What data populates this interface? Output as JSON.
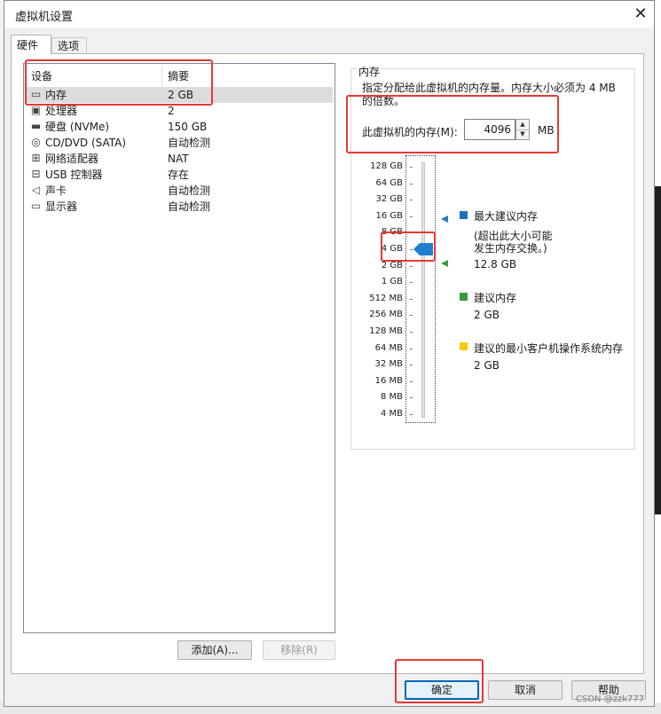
{
  "window": {
    "title": "虚拟机设置",
    "close": "✕"
  },
  "tabs": [
    {
      "label": "硬件"
    },
    {
      "label": "选项"
    }
  ],
  "device_table": {
    "headers": [
      "设备",
      "摘要"
    ],
    "rows": [
      {
        "name": "内存",
        "value": "2 GB",
        "icon": "memory-icon",
        "glyph": "▭"
      },
      {
        "name": "处理器",
        "value": "2",
        "icon": "cpu-icon",
        "glyph": "▣"
      },
      {
        "name": "硬盘 (NVMe)",
        "value": "150 GB",
        "icon": "harddisk-icon",
        "glyph": "▬"
      },
      {
        "name": "CD/DVD (SATA)",
        "value": "自动检测",
        "icon": "cd-icon",
        "glyph": "◎"
      },
      {
        "name": "网络适配器",
        "value": "NAT",
        "icon": "network-icon",
        "glyph": "⊞"
      },
      {
        "name": "USB 控制器",
        "value": "存在",
        "icon": "usb-icon",
        "glyph": "⊟"
      },
      {
        "name": "声卡",
        "value": "自动检测",
        "icon": "sound-icon",
        "glyph": "◁"
      },
      {
        "name": "显示器",
        "value": "自动检测",
        "icon": "monitor-icon",
        "glyph": "▭"
      }
    ]
  },
  "list_buttons": {
    "add": "添加(A)...",
    "remove": "移除(R)"
  },
  "memory": {
    "group_title": "内存",
    "description_line1": "指定分配给此虚拟机的内存量。内存大小必须为 4 MB",
    "description_line2": "的倍数。",
    "field_label": "此虚拟机的内存(M):",
    "value": "4096",
    "unit": "MB",
    "scale_labels": [
      "128 GB",
      "64 GB",
      "32 GB",
      "16 GB",
      "8 GB",
      "4 GB",
      "2 GB",
      "1 GB",
      "512 MB",
      "256 MB",
      "128 MB",
      "64 MB",
      "32 MB",
      "16 MB",
      "8 MB",
      "4 MB"
    ],
    "current_level": "4 GB",
    "legend": {
      "max_title": "最大建议内存",
      "max_note_line1": "(超出此大小可能",
      "max_note_line2": "发生内存交换。)",
      "max_value": "12.8 GB",
      "rec_title": "建议内存",
      "rec_value": "2 GB",
      "min_title": "建议的最小客户机操作系统内存",
      "min_value": "2 GB"
    },
    "colors": {
      "max": "#1e6fbf",
      "rec": "#3a9a3a",
      "min": "#f5cc00",
      "thumb": "#1e7fd0"
    }
  },
  "footer": {
    "ok": "确定",
    "cancel": "取消",
    "help": "帮助"
  },
  "watermark": "CSDN @zzk777"
}
